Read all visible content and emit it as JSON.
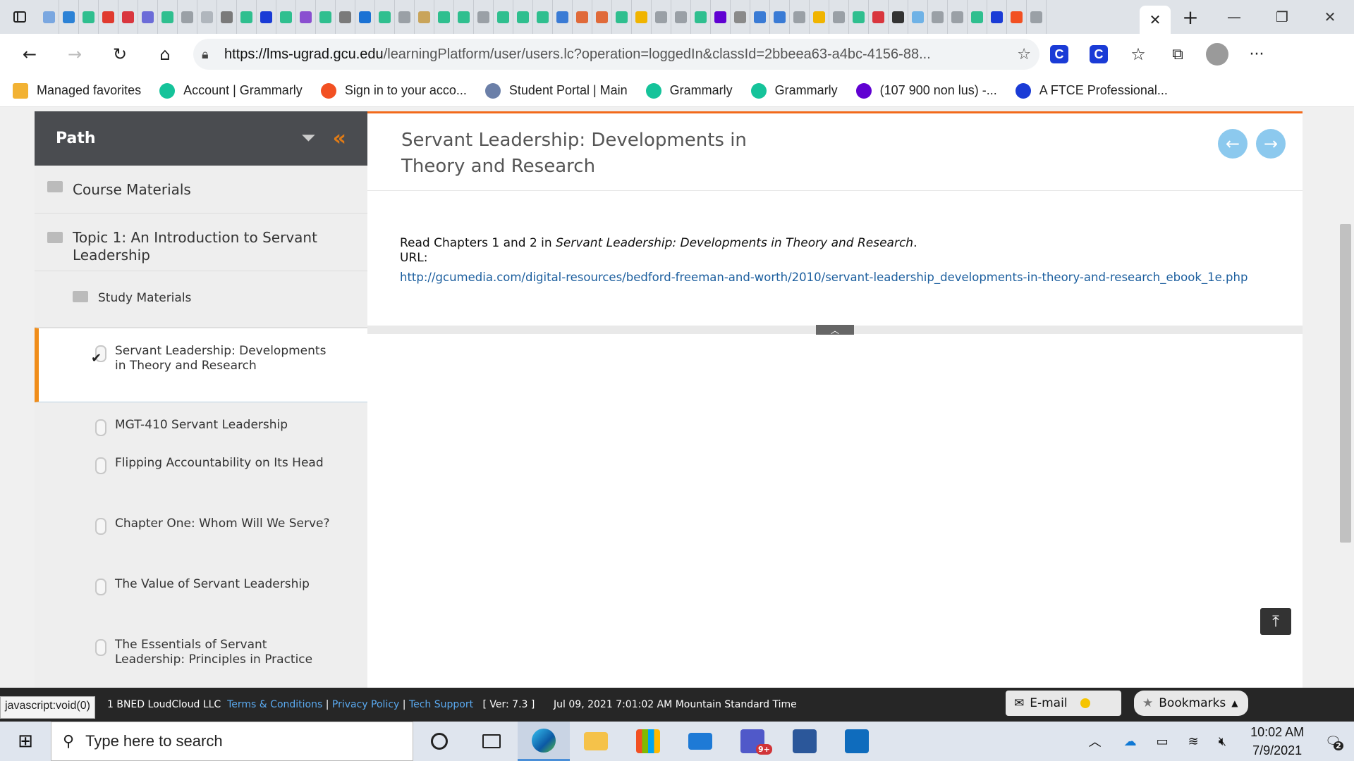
{
  "browser": {
    "tab_count_badge": "9+",
    "url_host": "https://lms-ugrad.gcu.edu",
    "url_path": "/learningPlatform/user/users.lc?operation=loggedIn&classId=2bbeea63-a4bc-4156-88...",
    "tab_close": "✕",
    "new_tab": "+",
    "favorites": [
      {
        "label": "Managed favorites",
        "color": "#f2b233"
      },
      {
        "label": "Account | Grammarly",
        "color": "#15c39a"
      },
      {
        "label": "Sign in to your acco...",
        "color": "#f25022"
      },
      {
        "label": "Student Portal | Main",
        "color": "#6b7fa8"
      },
      {
        "label": "Grammarly",
        "color": "#15c39a"
      },
      {
        "label": "Grammarly",
        "color": "#15c39a"
      },
      {
        "label": "(107 900 non lus) -...",
        "color": "#6001d2"
      },
      {
        "label": "A FTCE Professional...",
        "color": "#1a3bd6"
      }
    ]
  },
  "sidebar": {
    "title": "Path",
    "folders": [
      {
        "label": "Course Materials"
      },
      {
        "label": "Topic 1: An Introduction to Servant Leadership"
      },
      {
        "label": "Study Materials"
      }
    ],
    "items": [
      {
        "label": "Servant Leadership: Developments in Theory and Research",
        "active": true
      },
      {
        "label": "MGT-410 Servant Leadership"
      },
      {
        "label": "Flipping Accountability on Its Head"
      },
      {
        "label": "Chapter One: Whom Will We Serve?"
      },
      {
        "label": "The Value of Servant Leadership"
      },
      {
        "label": "The Essentials of Servant Leadership: Principles in Practice"
      }
    ]
  },
  "content": {
    "title": "Servant Leadership: Developments in Theory and Research",
    "body_prefix": "Read Chapters 1 and 2 in ",
    "body_book": "Servant Leadership: Developments in Theory and Research",
    "body_suffix": ".",
    "url_label": "URL:",
    "link": "http://gcumedia.com/digital-resources/bedford-freeman-and-worth/2010/servant-leadership_developments-in-theory-and-research_ebook_1e.php"
  },
  "footer": {
    "status_url": "javascript:void(0)",
    "company": "1 BNED LoudCloud LLC",
    "terms": "Terms & Conditions",
    "privacy": "Privacy Policy",
    "support": "Tech Support",
    "version": "[ Ver: 7.3 ]",
    "datetime": "Jul 09, 2021  7:01:02 AM Mountain Standard Time",
    "email": "E-mail",
    "bookmarks": "Bookmarks"
  },
  "taskbar": {
    "search_placeholder": "Type here to search",
    "time": "10:02 AM",
    "date": "7/9/2021",
    "notifications": "2"
  },
  "colors": {
    "accent_orange": "#f26a1b",
    "header_dark": "#4a4c50",
    "link_blue": "#1b5e9e"
  }
}
